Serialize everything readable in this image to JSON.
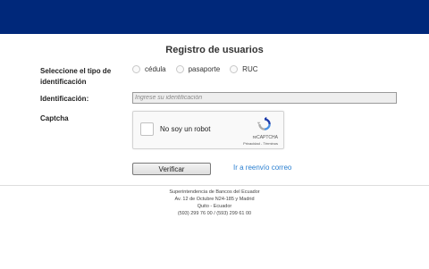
{
  "header": {
    "color": "#00287a"
  },
  "form": {
    "title": "Registro de usuarios",
    "tipo_label": "Seleccione el tipo de identificación",
    "tipo_options": [
      "cédula",
      "pasaporte",
      "RUC"
    ],
    "ident_label": "Identificación:",
    "ident_placeholder": "Ingrese su identificación",
    "ident_value": "",
    "captcha_label": "Captcha"
  },
  "recaptcha": {
    "checkbox_label": "No soy un robot",
    "brand": "reCAPTCHA",
    "links": "Privacidad - Términos",
    "checked": false
  },
  "actions": {
    "verify_label": "Verificar",
    "resend_link": "Ir a reenvío correo",
    "link_color": "#2a7fd0"
  },
  "footer": {
    "line1": "Superintendencia de Bancos del Ecuador",
    "line2": "Av. 12 de Octubre N24-185 y Madrid",
    "line3": "Quito - Ecuador",
    "line4": "(593) 299 76 00 / (593) 299 61 00"
  }
}
